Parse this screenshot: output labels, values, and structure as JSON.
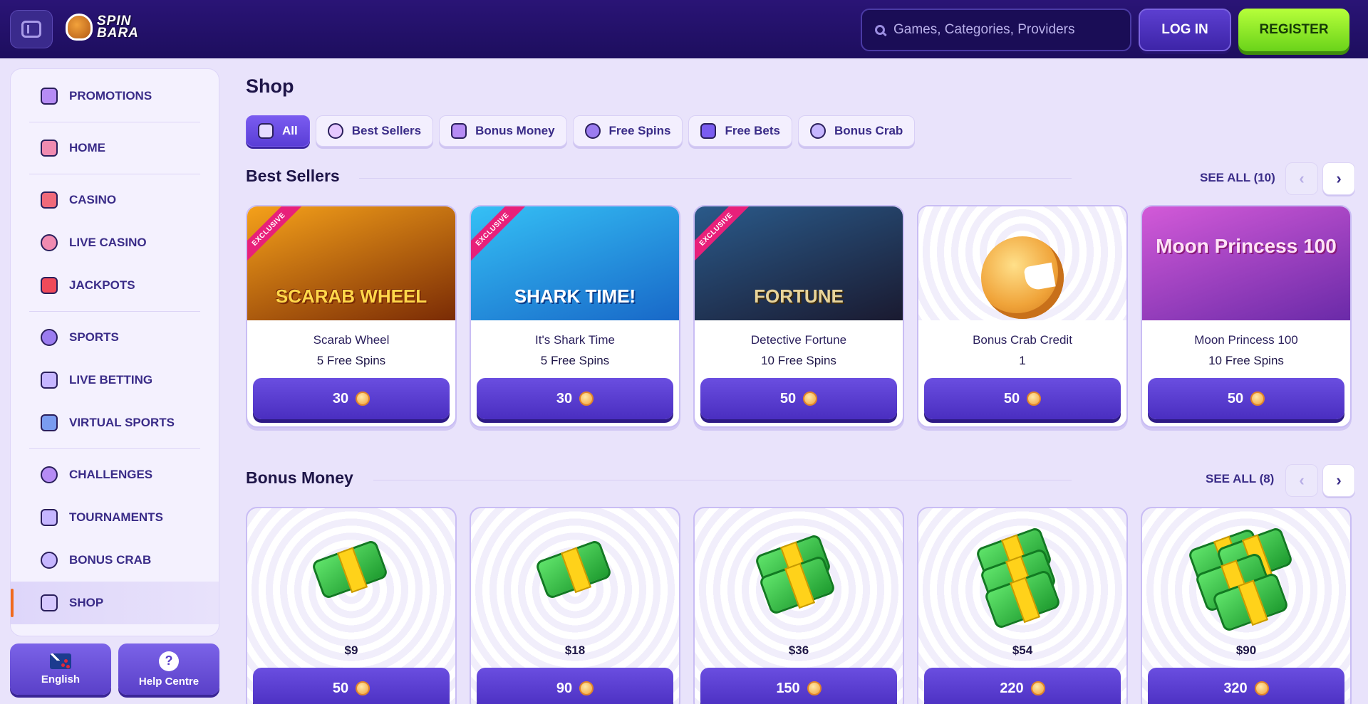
{
  "header": {
    "logo_text": "SPIN BARA",
    "search_placeholder": "Games, Categories, Providers",
    "login_label": "LOG IN",
    "register_label": "REGISTER"
  },
  "sidebar": {
    "items": [
      {
        "label": "PROMOTIONS",
        "icon": "gift-icon"
      },
      {
        "label": "HOME",
        "icon": "home-icon"
      },
      {
        "label": "CASINO",
        "icon": "slot-icon"
      },
      {
        "label": "LIVE CASINO",
        "icon": "chip-icon"
      },
      {
        "label": "JACKPOTS",
        "icon": "sevens-icon"
      },
      {
        "label": "SPORTS",
        "icon": "basketball-icon"
      },
      {
        "label": "LIVE BETTING",
        "icon": "live-icon"
      },
      {
        "label": "VIRTUAL SPORTS",
        "icon": "virtual-icon"
      },
      {
        "label": "CHALLENGES",
        "icon": "medal-icon"
      },
      {
        "label": "TOURNAMENTS",
        "icon": "trophy-icon"
      },
      {
        "label": "BONUS CRAB",
        "icon": "crab-icon"
      },
      {
        "label": "SHOP",
        "icon": "shop-icon"
      }
    ],
    "language_label": "English",
    "help_label": "Help Centre"
  },
  "main": {
    "title": "Shop",
    "filters": [
      {
        "label": "All",
        "active": true
      },
      {
        "label": "Best Sellers"
      },
      {
        "label": "Bonus Money"
      },
      {
        "label": "Free Spins"
      },
      {
        "label": "Free Bets"
      },
      {
        "label": "Bonus Crab"
      }
    ],
    "best_sellers": {
      "title": "Best Sellers",
      "see_all": "SEE ALL (10)",
      "cards": [
        {
          "name": "Scarab Wheel",
          "sub": "5 Free Spins",
          "price": "30",
          "ribbon": "EXCLUSIVE",
          "art": "SCARAB WHEEL",
          "colors": [
            "#f5a11a",
            "#7a2b05"
          ]
        },
        {
          "name": "It's Shark Time",
          "sub": "5 Free Spins",
          "price": "30",
          "ribbon": "EXCLUSIVE",
          "art": "SHARK TIME!",
          "colors": [
            "#35c0f5",
            "#1868c8"
          ]
        },
        {
          "name": "Detective Fortune",
          "sub": "10 Free Spins",
          "price": "50",
          "ribbon": "EXCLUSIVE",
          "art": "FORTUNE",
          "colors": [
            "#2a5a8a",
            "#1a1a30"
          ]
        },
        {
          "name": "Bonus Crab Credit",
          "sub": "1",
          "price": "50",
          "ribbon": "",
          "art": "",
          "colors": [
            "#ffffff",
            "#f1eefb"
          ]
        },
        {
          "name": "Moon Princess 100",
          "sub": "10 Free Spins",
          "price": "50",
          "ribbon": "",
          "art": "Moon Princess 100",
          "colors": [
            "#d35ad8",
            "#6a2aa8"
          ]
        }
      ]
    },
    "bonus_money": {
      "title": "Bonus Money",
      "see_all": "SEE ALL (8)",
      "cards": [
        {
          "amount": "$9",
          "price": "50"
        },
        {
          "amount": "$18",
          "price": "90"
        },
        {
          "amount": "$36",
          "price": "150"
        },
        {
          "amount": "$54",
          "price": "220"
        },
        {
          "amount": "$90",
          "price": "320"
        }
      ]
    }
  }
}
